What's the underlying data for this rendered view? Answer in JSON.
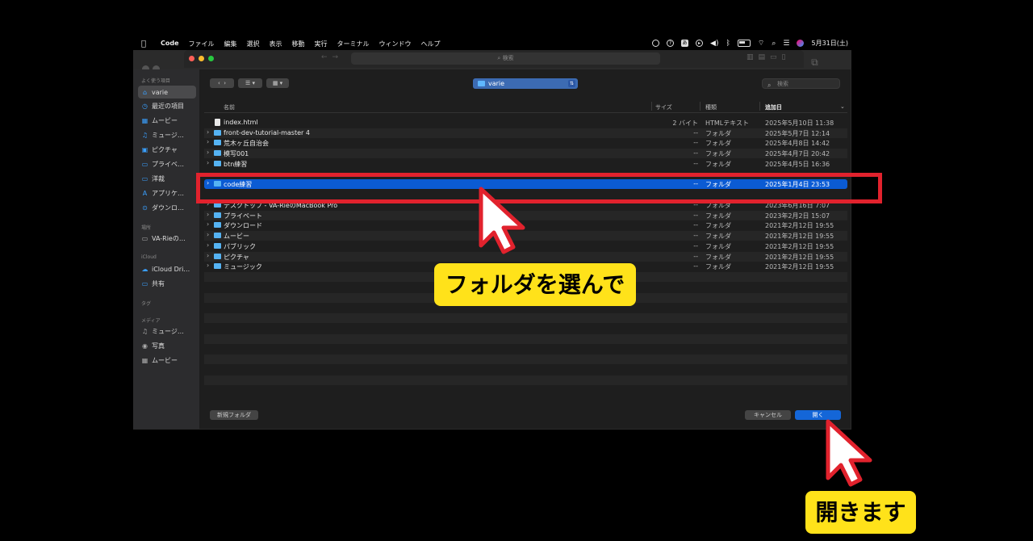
{
  "menubar": {
    "apple": "",
    "app": "Code",
    "menus": [
      "ファイル",
      "編集",
      "選択",
      "表示",
      "移動",
      "実行",
      "ターミナル",
      "ウィンドウ",
      "ヘルプ"
    ],
    "input_mode": "あ",
    "clock": "5月31日(土)"
  },
  "titlebar": {
    "search_placeholder": "検索"
  },
  "sidebar": {
    "favorites_label": "よく使う項目",
    "favorites": [
      {
        "label": "varie",
        "icon": "home-icon",
        "selected": true
      },
      {
        "label": "最近の項目",
        "icon": "clock-icon"
      },
      {
        "label": "ムービー",
        "icon": "film-icon"
      },
      {
        "label": "ミュージ…",
        "icon": "music-icon"
      },
      {
        "label": "ピクチャ",
        "icon": "photo-icon"
      },
      {
        "label": "プライベ…",
        "icon": "folder-icon"
      },
      {
        "label": "洋裁",
        "icon": "folder-icon"
      },
      {
        "label": "アプリケ…",
        "icon": "apps-icon"
      },
      {
        "label": "ダウンロ…",
        "icon": "download-icon"
      }
    ],
    "locations_label": "場所",
    "locations": [
      {
        "label": "VA-Rieの…",
        "icon": "laptop-icon"
      }
    ],
    "icloud_label": "iCloud",
    "icloud": [
      {
        "label": "iCloud Dri…",
        "icon": "cloud-icon"
      },
      {
        "label": "共有",
        "icon": "shared-folder-icon"
      }
    ],
    "tags_label": "タグ",
    "media_label": "メディア",
    "media": [
      {
        "label": "ミュージ…",
        "icon": "music-icon"
      },
      {
        "label": "写真",
        "icon": "camera-icon"
      },
      {
        "label": "ムービー",
        "icon": "film-icon"
      }
    ]
  },
  "toolbar": {
    "path": "varie",
    "search_placeholder": "検索"
  },
  "columns": {
    "name": "名前",
    "size": "サイズ",
    "kind": "種類",
    "date": "追加日"
  },
  "files": [
    {
      "name": "index.html",
      "size": "2 バイト",
      "kind": "HTMLテキスト",
      "date": "2025年5月10日 11:38",
      "type": "file"
    },
    {
      "name": "front-dev-tutorial-master 4",
      "size": "--",
      "kind": "フォルダ",
      "date": "2025年5月7日 12:14",
      "type": "folder"
    },
    {
      "name": "荒木ヶ丘自治会",
      "size": "--",
      "kind": "フォルダ",
      "date": "2025年4月8日 14:42",
      "type": "folder"
    },
    {
      "name": "模写001",
      "size": "--",
      "kind": "フォルダ",
      "date": "2025年4月7日 20:42",
      "type": "folder"
    },
    {
      "name": "btn練習",
      "size": "--",
      "kind": "フォルダ",
      "date": "2025年4月5日 16:36",
      "type": "folder"
    },
    {
      "name": "code練習",
      "size": "--",
      "kind": "フォルダ",
      "date": "2025年1月4日 23:53",
      "type": "folder",
      "selected": true
    },
    {
      "name": "デスクトップ - VA-RieのMacBook Pro",
      "size": "--",
      "kind": "フォルダ",
      "date": "2023年6月16日 7:07",
      "type": "folder"
    },
    {
      "name": "プライベート",
      "size": "--",
      "kind": "フォルダ",
      "date": "2023年2月2日 15:07",
      "type": "folder"
    },
    {
      "name": "ダウンロード",
      "size": "--",
      "kind": "フォルダ",
      "date": "2021年2月12日 19:55",
      "type": "folder"
    },
    {
      "name": "ムービー",
      "size": "--",
      "kind": "フォルダ",
      "date": "2021年2月12日 19:55",
      "type": "folder"
    },
    {
      "name": "パブリック",
      "size": "--",
      "kind": "フォルダ",
      "date": "2021年2月12日 19:55",
      "type": "folder"
    },
    {
      "name": "ピクチャ",
      "size": "--",
      "kind": "フォルダ",
      "date": "2021年2月12日 19:55",
      "type": "folder"
    },
    {
      "name": "ミュージック",
      "size": "--",
      "kind": "フォルダ",
      "date": "2021年2月12日 19:55",
      "type": "folder"
    }
  ],
  "buttons": {
    "new_folder": "新規フォルダ",
    "cancel": "キャンセル",
    "open": "開く"
  },
  "annotations": {
    "select_folder": "フォルダを選んで",
    "open": "開きます"
  },
  "colors": {
    "selection": "#0b5bd3",
    "highlight": "#e1222d",
    "callout": "#ffe21a",
    "folder": "#55b3f3"
  }
}
